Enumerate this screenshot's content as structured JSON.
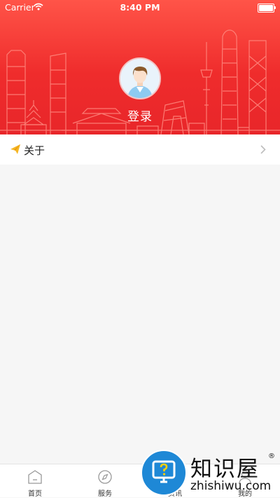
{
  "status_bar": {
    "carrier": "Carrier",
    "time": "8:40 PM",
    "battery_level": 1.0
  },
  "profile": {
    "login_label": "登录",
    "avatar_icon": "user-avatar-icon"
  },
  "menu": {
    "about": {
      "label": "关于",
      "icon": "paper-plane-icon"
    }
  },
  "tabbar": {
    "tabs": [
      {
        "label": "首页",
        "icon": "home-icon"
      },
      {
        "label": "服务",
        "icon": "compass-icon"
      },
      {
        "label": "资讯",
        "icon": "news-icon"
      },
      {
        "label": "我的",
        "icon": "user-icon"
      }
    ]
  },
  "watermark": {
    "name": "知识屋",
    "site": "zhishiwu.com",
    "reg": "®"
  },
  "colors": {
    "header_red": "#ef2c2c",
    "watermark_blue": "#1e88d6"
  }
}
